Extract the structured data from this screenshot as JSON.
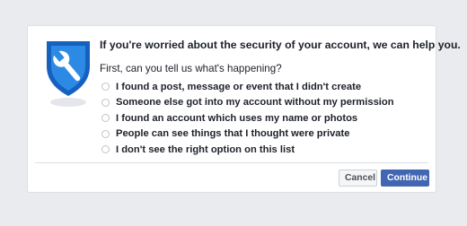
{
  "dialog": {
    "title": "If you're worried about the security of your account, we can help you.",
    "subtitle": "First, can you tell us what's happening?",
    "options": [
      {
        "label": "I found a post, message or event that I didn't create",
        "selected": false
      },
      {
        "label": "Someone else got into my account without my permission",
        "selected": false
      },
      {
        "label": "I found an account which uses my name or photos",
        "selected": false
      },
      {
        "label": "People can see things that I thought were private",
        "selected": false
      },
      {
        "label": "I don't see the right option on this list",
        "selected": false
      }
    ],
    "buttons": {
      "cancel_label": "Cancel",
      "continue_label": "Continue"
    },
    "icon": "shield-wrench-icon"
  },
  "colors": {
    "background": "#e9ebee",
    "shield_blue": "#1f76d3",
    "primary_button": "#4267b2"
  }
}
